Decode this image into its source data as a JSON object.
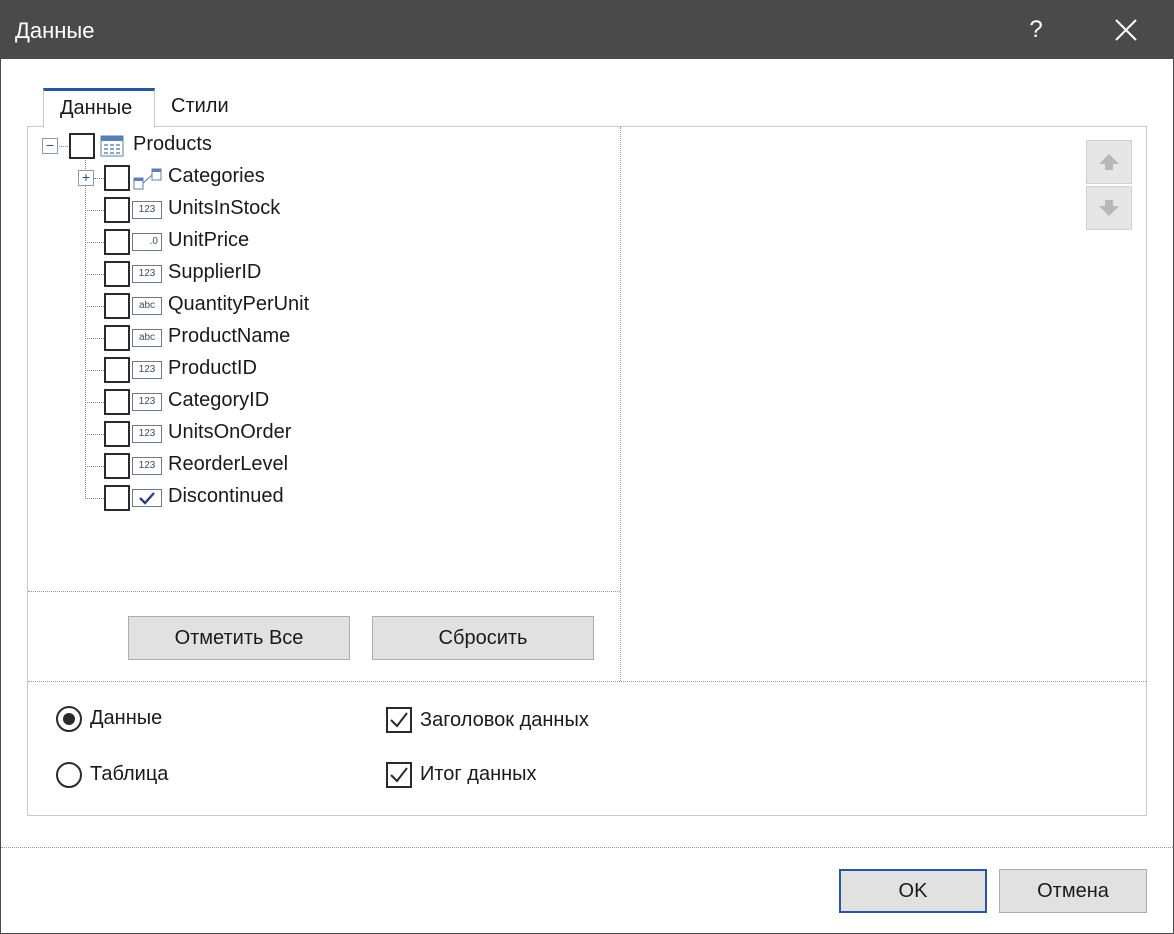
{
  "window": {
    "title": "Данные",
    "help_label": "?"
  },
  "tabs": [
    {
      "label": "Данные",
      "active": true
    },
    {
      "label": "Стили",
      "active": false
    }
  ],
  "tree": {
    "root": {
      "label": "Products",
      "expanded": true,
      "checked": false
    },
    "children": [
      {
        "label": "Categories",
        "type": "relation",
        "icon_text": "",
        "checked": false,
        "expandable": true
      },
      {
        "label": "UnitsInStock",
        "type": "number",
        "icon_text": "123",
        "checked": false
      },
      {
        "label": "UnitPrice",
        "type": "decimal",
        "icon_text": ".0",
        "checked": false
      },
      {
        "label": "SupplierID",
        "type": "number",
        "icon_text": "123",
        "checked": false
      },
      {
        "label": "QuantityPerUnit",
        "type": "text",
        "icon_text": "abc",
        "checked": false
      },
      {
        "label": "ProductName",
        "type": "text",
        "icon_text": "abc",
        "checked": false
      },
      {
        "label": "ProductID",
        "type": "number",
        "icon_text": "123",
        "checked": false
      },
      {
        "label": "CategoryID",
        "type": "number",
        "icon_text": "123",
        "checked": false
      },
      {
        "label": "UnitsOnOrder",
        "type": "number",
        "icon_text": "123",
        "checked": false
      },
      {
        "label": "ReorderLevel",
        "type": "number",
        "icon_text": "123",
        "checked": false
      },
      {
        "label": "Discontinued",
        "type": "boolean",
        "icon_text": "",
        "checked": false
      }
    ]
  },
  "buttons": {
    "select_all": "Отметить Все",
    "reset": "Сбросить",
    "ok": "OK",
    "cancel": "Отмена"
  },
  "options": {
    "radio": [
      {
        "label": "Данные",
        "selected": true
      },
      {
        "label": "Таблица",
        "selected": false
      }
    ],
    "checkboxes": [
      {
        "label": "Заголовок данных",
        "checked": true
      },
      {
        "label": "Итог данных",
        "checked": true
      }
    ]
  },
  "colors": {
    "titlebar": "#4a4a4a",
    "accent": "#2b579a",
    "button": "#e1e1e1",
    "ok_border": "#2b579a"
  }
}
